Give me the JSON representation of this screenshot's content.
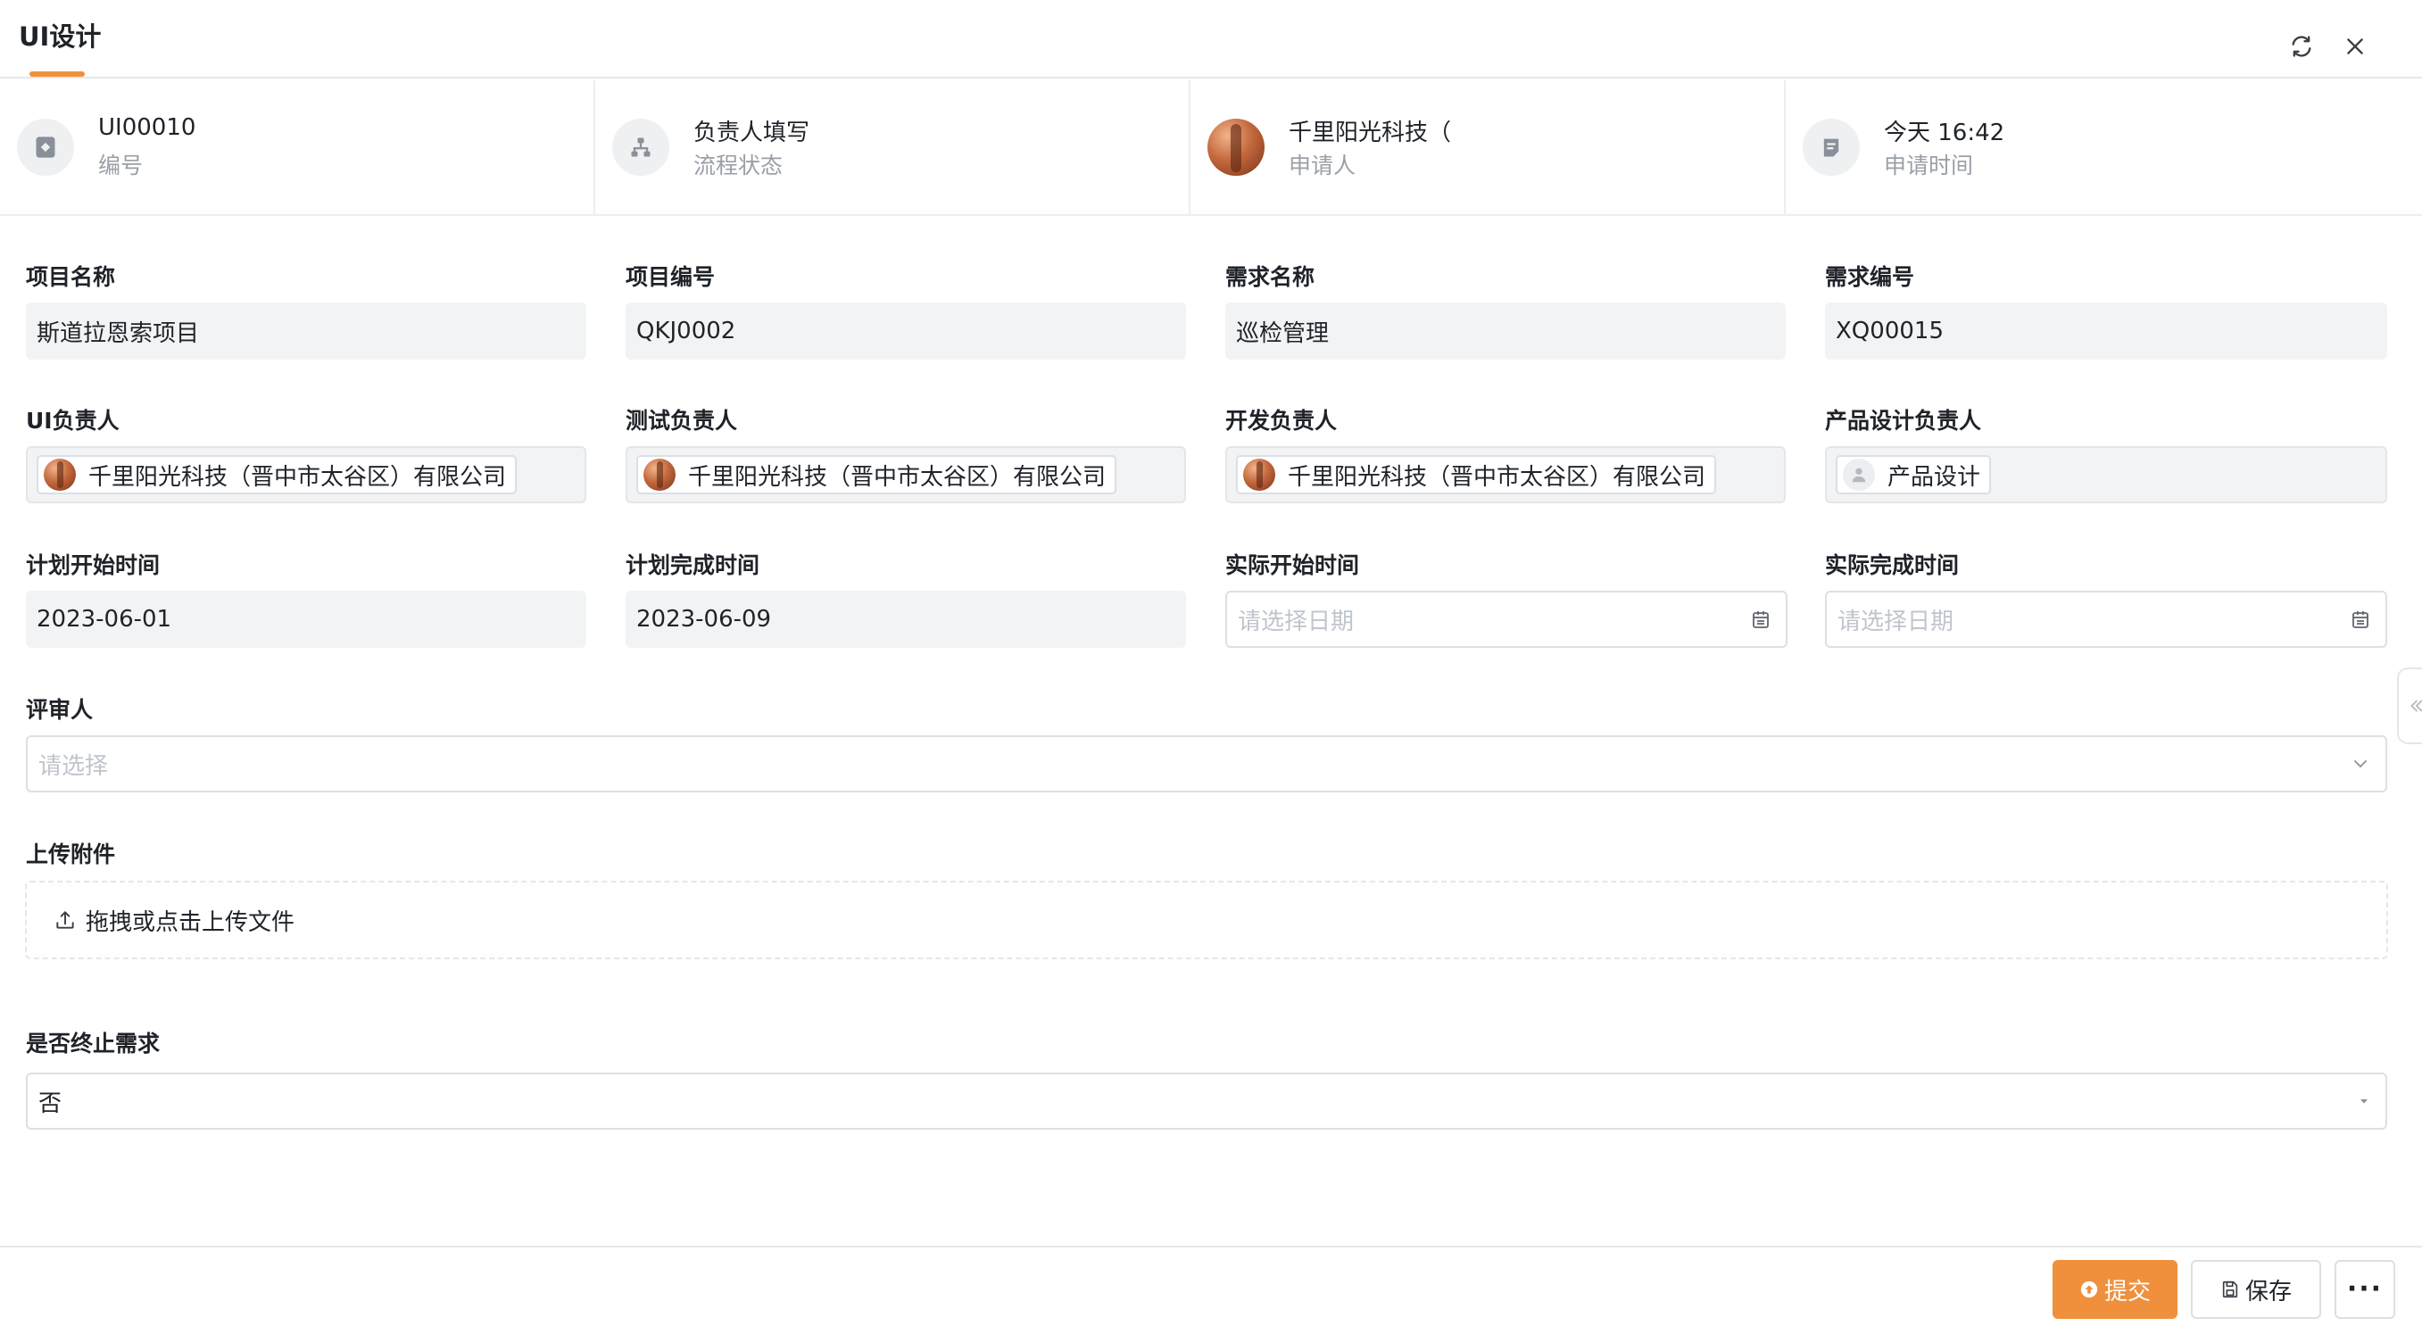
{
  "header": {
    "title": "UI设计",
    "refresh_icon": "refresh-icon",
    "close_icon": "close-icon"
  },
  "info": [
    {
      "icon": "form-id-icon",
      "value": "UI00010",
      "label": "编号"
    },
    {
      "icon": "org-chart-icon",
      "value": "负责人填写",
      "label": "流程状态"
    },
    {
      "icon": "avatar",
      "value": "千里阳光科技（",
      "label": "申请人"
    },
    {
      "icon": "calendar-note-icon",
      "value": "今天 16:42",
      "label": "申请时间"
    }
  ],
  "form": {
    "project_name": {
      "label": "项目名称",
      "value": "斯道拉恩索项目"
    },
    "project_code": {
      "label": "项目编号",
      "value": "QKJ0002"
    },
    "req_name": {
      "label": "需求名称",
      "value": "巡检管理"
    },
    "req_code": {
      "label": "需求编号",
      "value": "XQ00015"
    },
    "ui_owner": {
      "label": "UI负责人",
      "value": "千里阳光科技（晋中市太谷区）有限公司"
    },
    "test_owner": {
      "label": "测试负责人",
      "value": "千里阳光科技（晋中市太谷区）有限公司"
    },
    "dev_owner": {
      "label": "开发负责人",
      "value": "千里阳光科技（晋中市太谷区）有限公司"
    },
    "product_owner": {
      "label": "产品设计负责人",
      "value": "产品设计"
    },
    "plan_start": {
      "label": "计划开始时间",
      "value": "2023-06-01"
    },
    "plan_end": {
      "label": "计划完成时间",
      "value": "2023-06-09"
    },
    "actual_start": {
      "label": "实际开始时间",
      "placeholder": "请选择日期"
    },
    "actual_end": {
      "label": "实际完成时间",
      "placeholder": "请选择日期"
    },
    "reviewer": {
      "label": "评审人",
      "placeholder": "请选择"
    },
    "attachment": {
      "label": "上传附件",
      "button": "拖拽或点击上传文件"
    },
    "terminate": {
      "label": "是否终止需求",
      "value": "否"
    }
  },
  "footer": {
    "submit": "提交",
    "save": "保存",
    "more": "···"
  },
  "colors": {
    "accent": "#f0903c",
    "readonly_bg": "#f2f3f5",
    "border": "#dcdfe4",
    "muted_text": "#9aa0a8"
  }
}
